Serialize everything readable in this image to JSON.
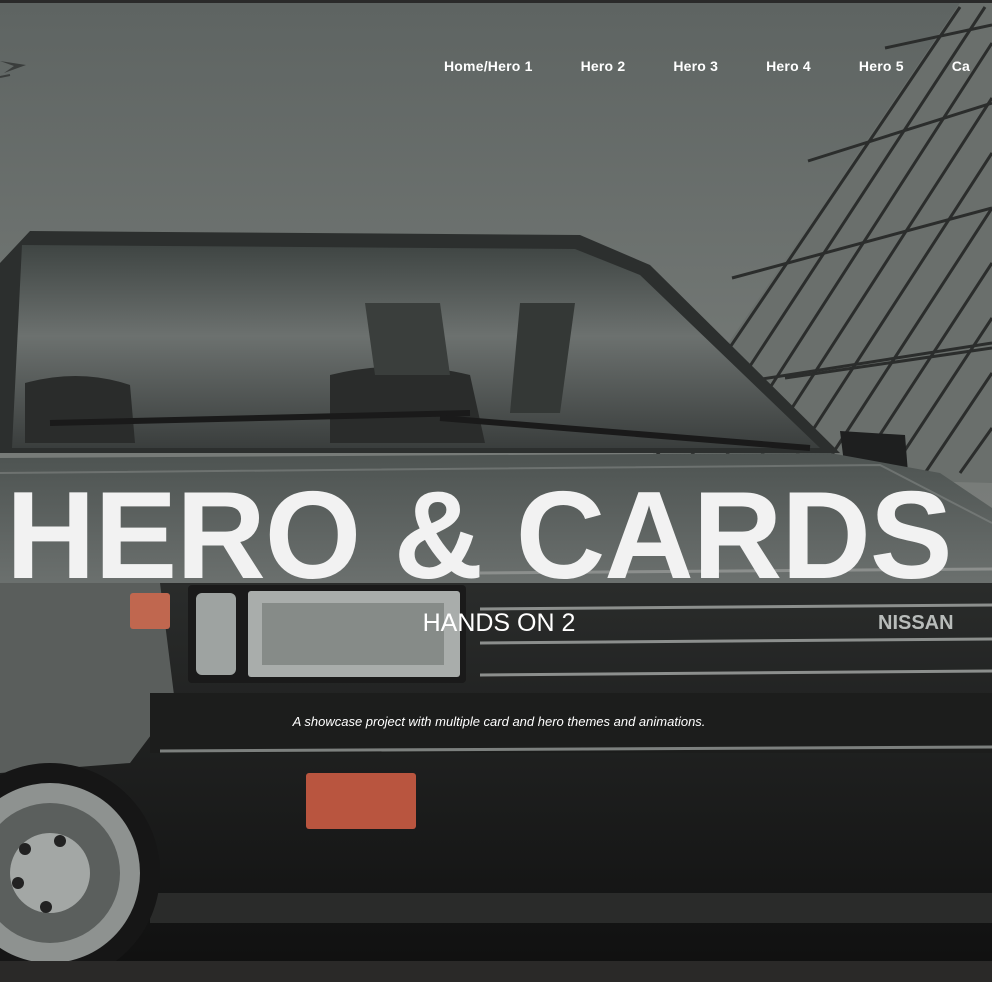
{
  "nav": {
    "items": [
      {
        "label": "Home/Hero 1"
      },
      {
        "label": "Hero 2"
      },
      {
        "label": "Hero 3"
      },
      {
        "label": "Hero 4"
      },
      {
        "label": "Hero 5"
      },
      {
        "label": "Ca"
      }
    ]
  },
  "hero": {
    "title": "HERO & CARDS",
    "subtitle": "HANDS ON 2",
    "description": "A showcase project with multiple card and hero themes and animations.",
    "badge_text": "NISSAN"
  },
  "colors": {
    "sky": "#6f7472",
    "text": "#ffffff",
    "car_dark": "#151515"
  }
}
